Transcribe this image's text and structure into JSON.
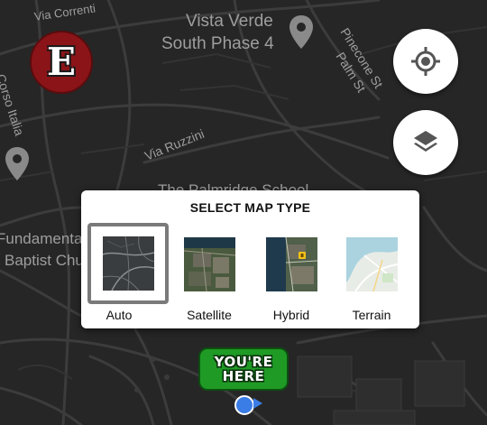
{
  "map": {
    "labels": {
      "via_correnti": "Via Correnti",
      "vista_verde_line1": "Vista Verde",
      "vista_verde_line2": "South Phase 4",
      "pinecone_line1": "Pinecone St",
      "pinecone_line2": "Palm St",
      "corso_italia": "Corso Italia",
      "via_ruzzini": "Via Ruzzini",
      "school_partial": "The Palmridge School",
      "church_line1": "Fundamental",
      "church_line2": "Baptist Church"
    },
    "colors": {
      "background": "#262626",
      "roads": "#3c3c3c",
      "labels": "#9e9e9e"
    }
  },
  "logo": {
    "letter": "E",
    "color": "#8b1418"
  },
  "buttons": {
    "my_location_icon": "crosshair-icon",
    "layers_icon": "layers-icon"
  },
  "map_type_panel": {
    "title": "SELECT MAP TYPE",
    "selected": "Auto",
    "options": [
      {
        "label": "Auto"
      },
      {
        "label": "Satellite"
      },
      {
        "label": "Hybrid"
      },
      {
        "label": "Terrain"
      }
    ]
  },
  "marker": {
    "line1": "YOU'RE",
    "line2": "HERE",
    "color": "#1f9a25"
  },
  "location_dot_color": "#3b7de6"
}
